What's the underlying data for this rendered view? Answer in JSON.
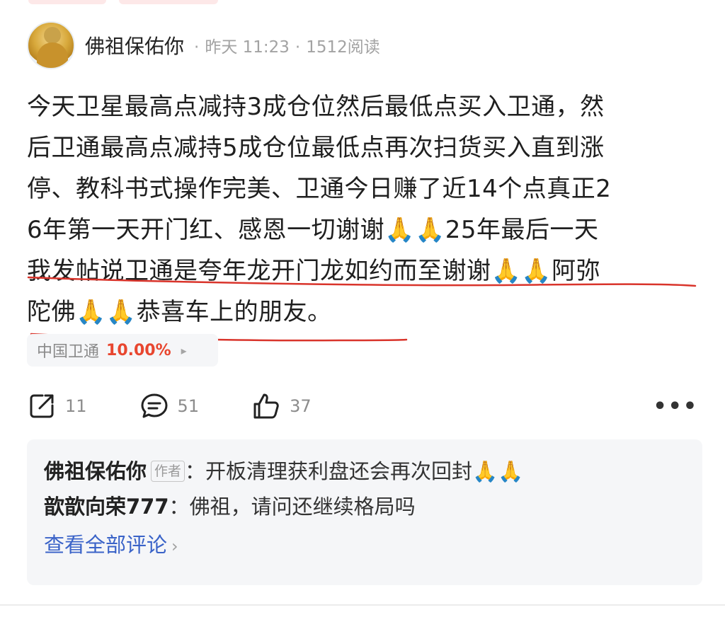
{
  "post": {
    "author": "佛祖保佑你",
    "time": "昨天 11:23",
    "reads": "1512阅读",
    "content_lines": [
      "今天卫星最高点减持3成仓位然后最低点买入卫通，然",
      "后卫通最高点减持5成仓位最低点再次扫货买入直到涨",
      "停、教科书式操作完美、卫通今日赚了近14个点真正2",
      "6年第一天开门红、感恩一切谢谢🙏🙏25年最后一天",
      "我发帖说卫通是夸年龙开门龙如约而至谢谢🙏🙏阿弥",
      "陀佛🙏🙏恭喜车上的朋友。"
    ]
  },
  "stock": {
    "name": "中国卫通",
    "change": "10.00%"
  },
  "actions": {
    "share_count": "11",
    "comment_count": "51",
    "like_count": "37"
  },
  "comments": [
    {
      "author": "佛祖保佑你",
      "badge": "作者",
      "text": "开板清理获利盘还会再次回封🙏🙏"
    },
    {
      "author": "歆歆向荣777",
      "text": "佛祖，请问还继续格局吗"
    }
  ],
  "view_all_label": "查看全部评论",
  "colors": {
    "accent_red": "#e8462f",
    "link_blue": "#3a63c8",
    "underline_red": "#d9342b"
  }
}
